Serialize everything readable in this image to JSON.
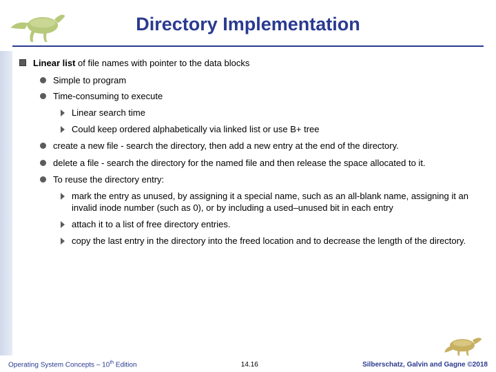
{
  "title": "Directory Implementation",
  "bullets": {
    "main": {
      "prefix": "Linear list",
      "rest": " of file names with pointer to the data blocks"
    },
    "sub1": "Simple to program",
    "sub2": "Time-consuming to execute",
    "sub2a": "Linear search time",
    "sub2b": "Could keep ordered alphabetically via linked list or use B+ tree",
    "sub3": "create a new file - search the directory, then add a new entry at the end of the directory.",
    "sub4": "delete a file - search the directory for the named file and then release the space allocated to it.",
    "sub5": "To reuse the directory entry:",
    "sub5a": "mark the entry as unused, by assigning it a special name, such as an all-blank name, assigning it an invalid inode number (such as 0), or by including a used–unused bit in each entry",
    "sub5b": "attach it to a list of free directory entries.",
    "sub5c": "copy the last entry in the directory into the freed location and to decrease the length of the directory."
  },
  "footer": {
    "left_prefix": "Operating System Concepts – 10",
    "left_sup": "th",
    "left_suffix": " Edition",
    "center": "14.16",
    "right": "Silberschatz, Galvin and Gagne ©2018"
  }
}
